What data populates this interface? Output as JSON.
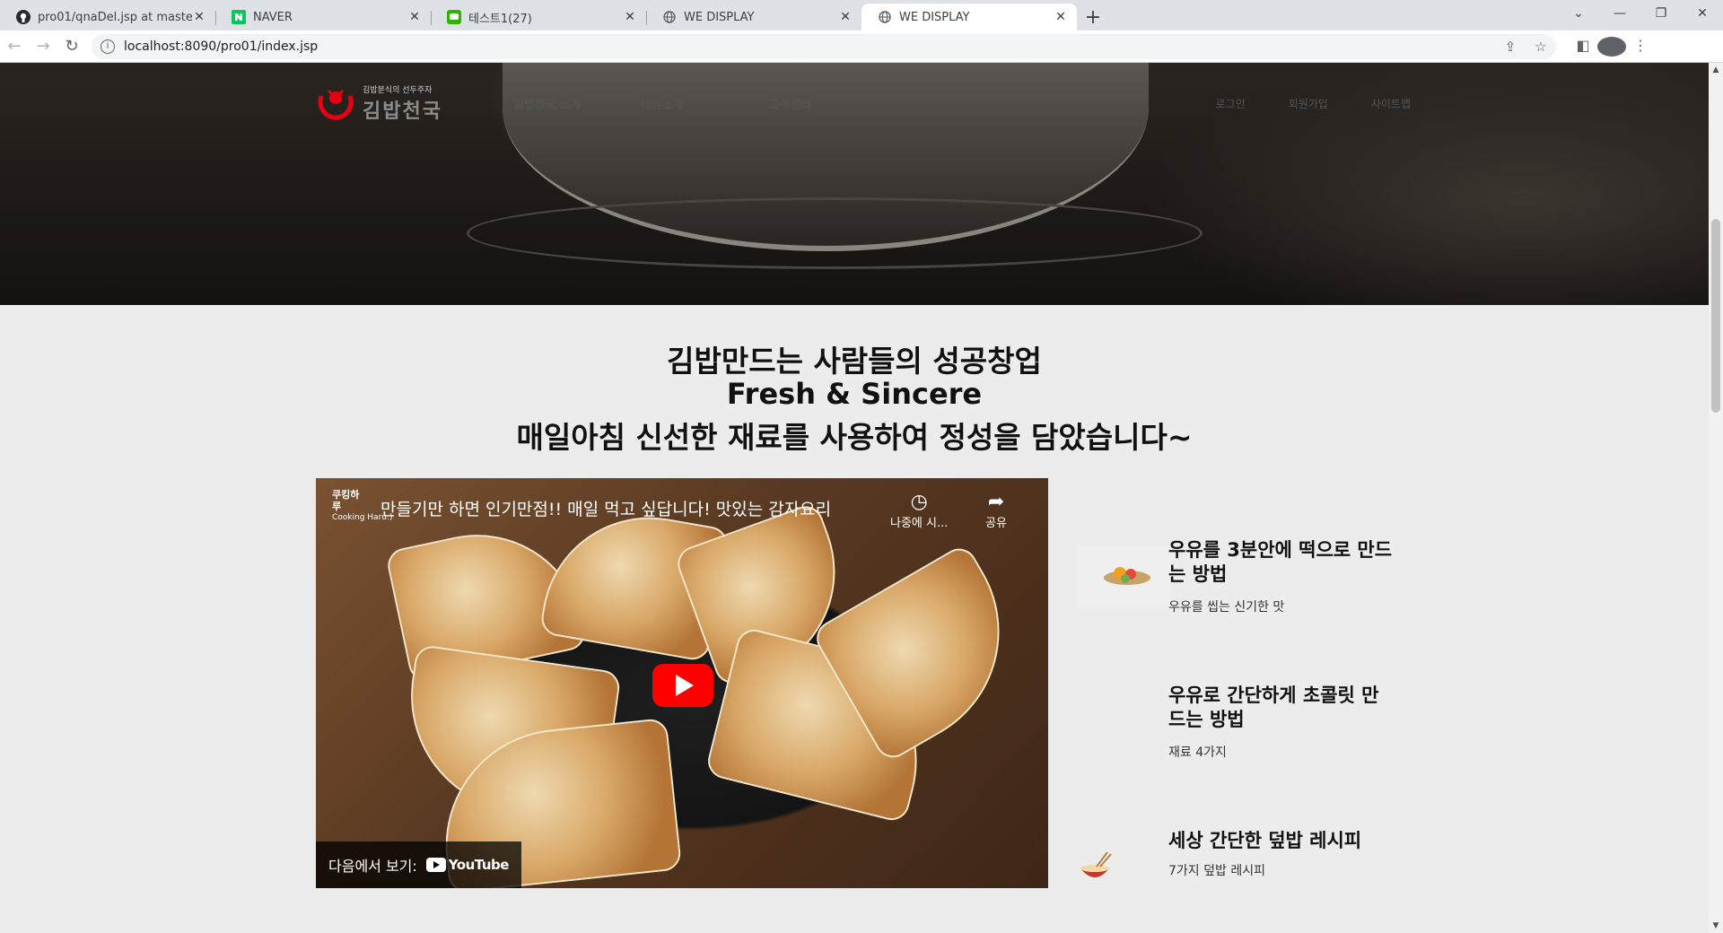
{
  "browser": {
    "tabs": [
      {
        "title": "pro01/qnaDel.jsp at master · ok",
        "icon": "github-icon",
        "active": false
      },
      {
        "title": "NAVER",
        "icon": "naver-icon",
        "active": false
      },
      {
        "title": "테스트1(27)",
        "icon": "chat-icon",
        "active": false
      },
      {
        "title": "WE DISPLAY",
        "icon": "globe-icon",
        "active": false
      },
      {
        "title": "WE DISPLAY",
        "icon": "globe-icon",
        "active": true
      }
    ],
    "url": "localhost:8090/pro01/index.jsp"
  },
  "site": {
    "logo_subtitle": "김밥분식의 선두주자",
    "logo_name": "김밥천국",
    "menu": [
      "김밥천국 소개",
      "메뉴소개",
      "고객센터"
    ],
    "util": [
      "로그인",
      "회원가입",
      "사이트맵"
    ]
  },
  "headline": {
    "line1": "김밥만드는 사람들의 성공창업",
    "line2": "Fresh & Sincere",
    "line3": "매일아침 신선한 재료를 사용하여 정성을 담았습니다~"
  },
  "video": {
    "channel_logo": "쿠킹하루",
    "channel_tagline": "Cooking Haru:)",
    "title": "만들기만 하면 인기만점!! 매일 먹고 싶답니다! 맛있는 감자요리",
    "watch_later": "나중에 시...",
    "share": "공유",
    "watch_on": "다음에서 보기:",
    "youtube": "YouTube"
  },
  "recipes": [
    {
      "title": "우유를 3분안에 떡으로 만드는 방법",
      "desc": "우유를 씹는 신기한 맛",
      "thumb": "rice-cake-dish-icon"
    },
    {
      "title": "우유로 간단하게 초콜릿 만드는 방법",
      "desc": "재료 4가지",
      "thumb": ""
    },
    {
      "title": "세상 간단한 덮밥 레시피",
      "desc": "7가지 덮밥 레시피",
      "thumb": "rice-bowl-chopsticks-icon"
    }
  ]
}
